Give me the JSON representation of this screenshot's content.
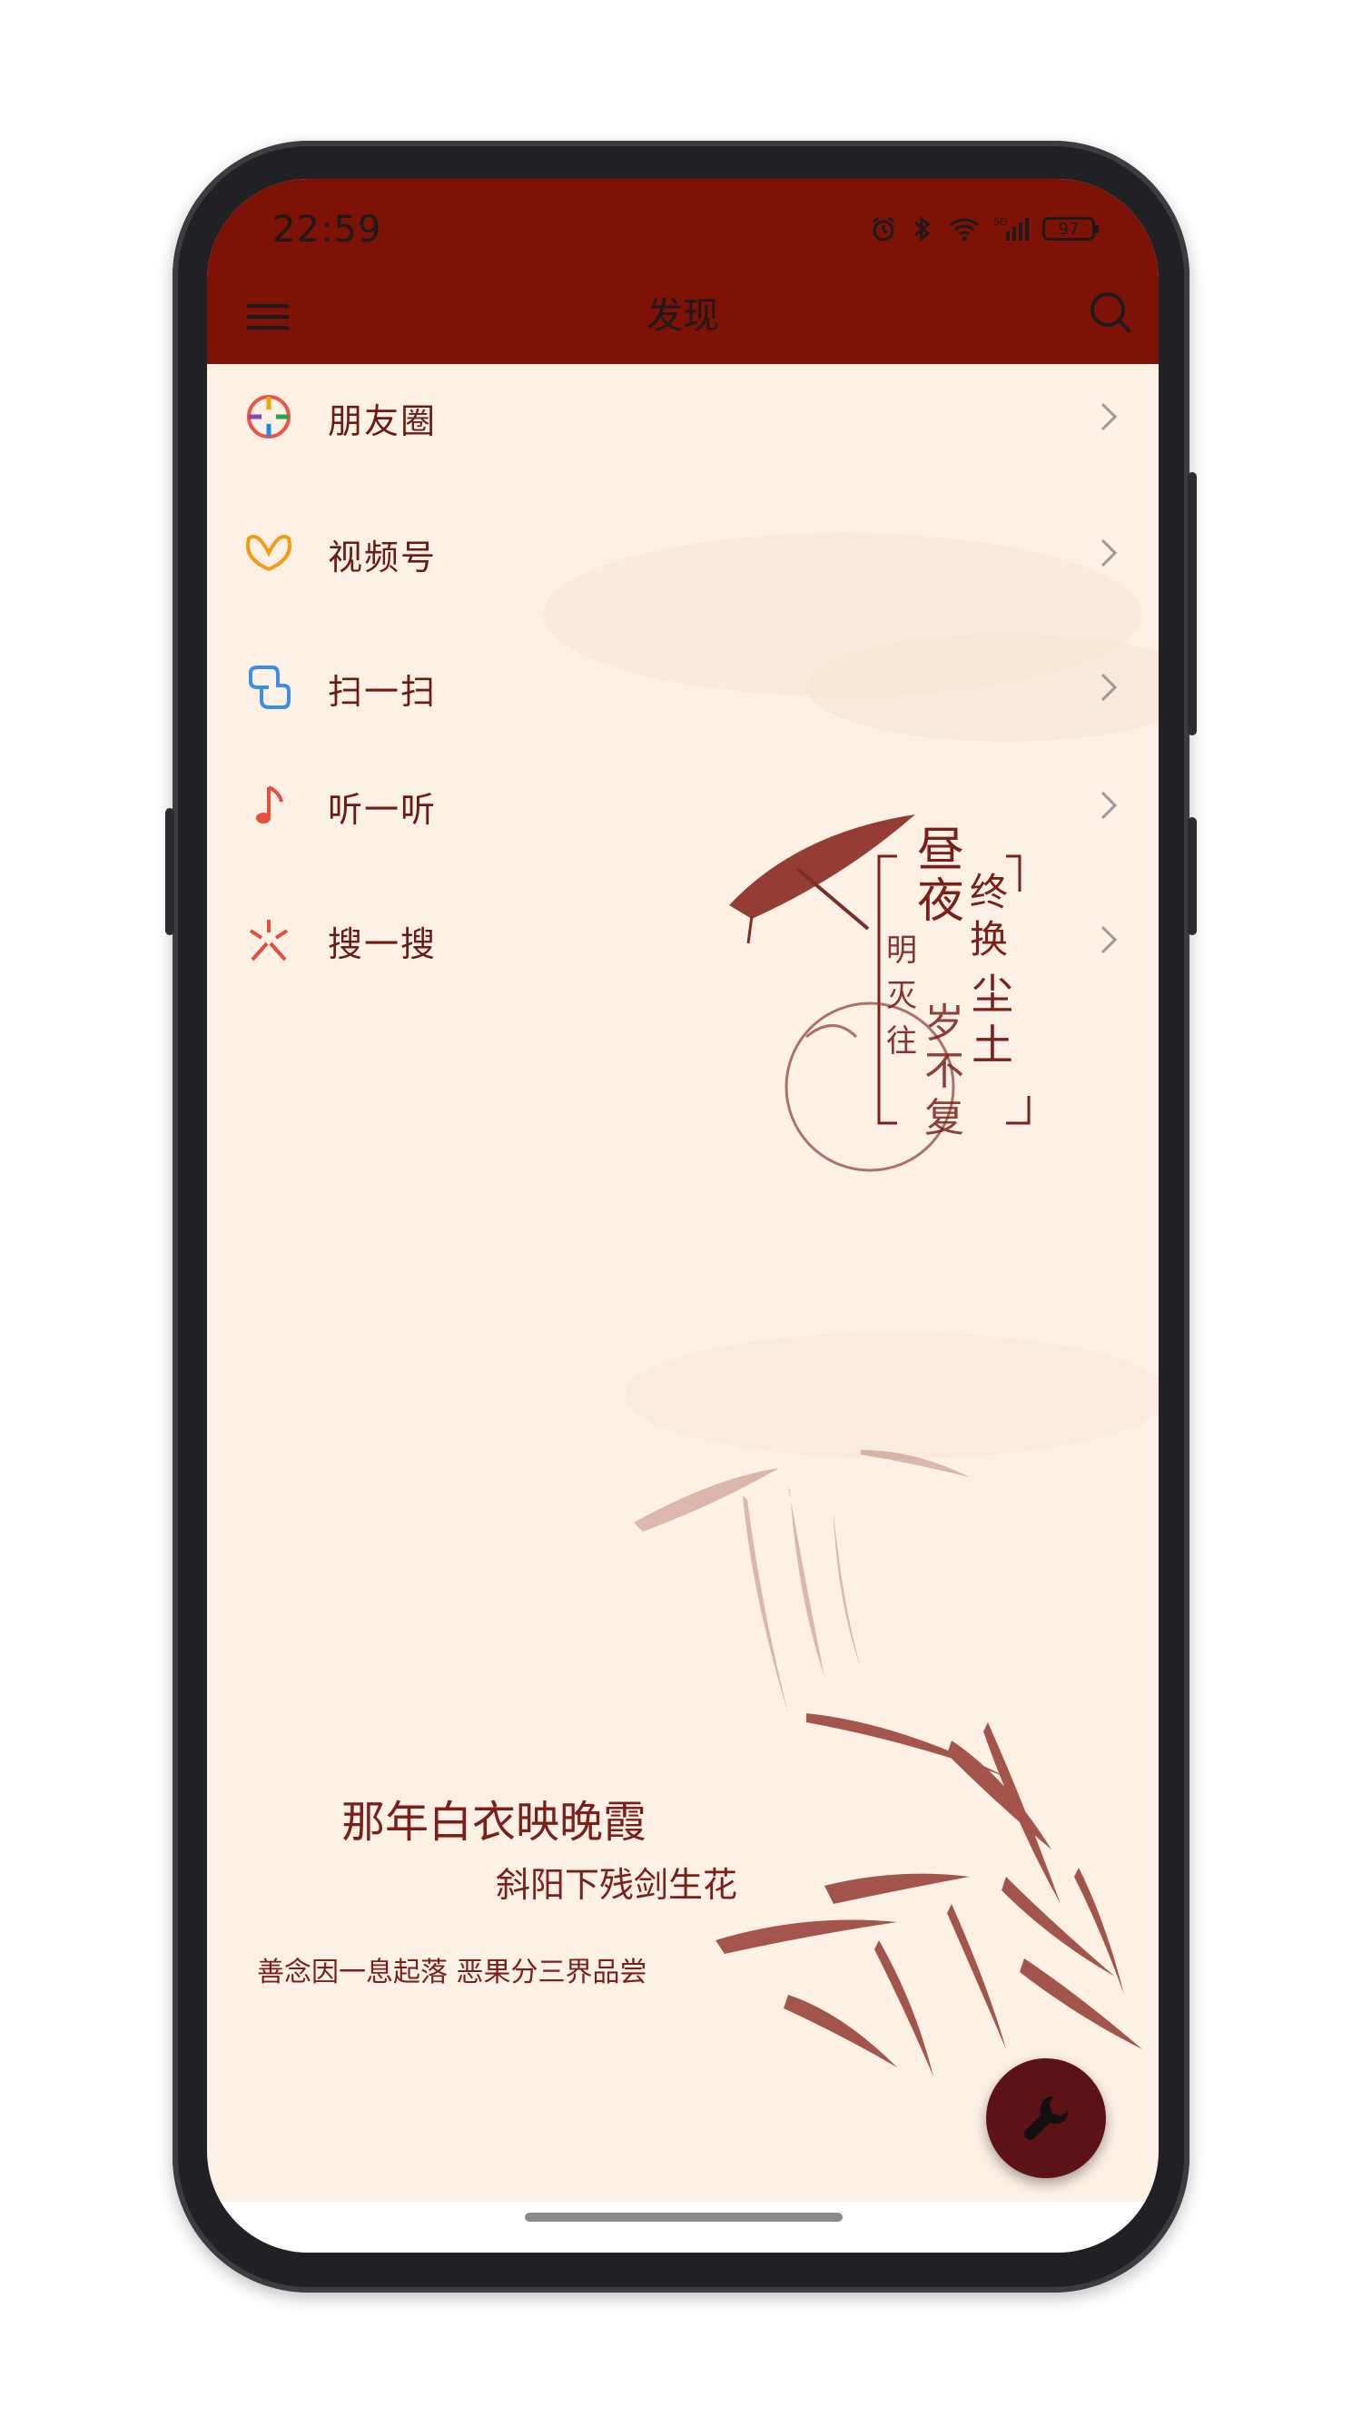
{
  "status_bar": {
    "time": "22:59",
    "battery": "97",
    "network": "5G"
  },
  "nav": {
    "title": "发现"
  },
  "menu": {
    "items": [
      {
        "label": "朋友圈",
        "icon": "moments-icon"
      },
      {
        "label": "视频号",
        "icon": "channels-icon"
      },
      {
        "label": "扫一扫",
        "icon": "scan-icon"
      },
      {
        "label": "听一听",
        "icon": "music-note-icon"
      },
      {
        "label": "搜一搜",
        "icon": "search-sparkle-icon"
      }
    ]
  },
  "wallpaper": {
    "vertical_poem_col1": "昼夜",
    "vertical_poem_col2": "明灭往",
    "vertical_poem_col3": "终换",
    "vertical_poem_col4": "岁不复",
    "vertical_poem_col5": "尘土",
    "bottom_line1": "那年白衣映晚霞",
    "bottom_line2": "斜阳下残剑生花",
    "bottom_line3": "善念因一息起落  恶果分三界品尝"
  },
  "colors": {
    "topbar": "#7e1206",
    "background": "#fdf1e6",
    "text": "#6e1a14",
    "fab": "#5c1216"
  }
}
